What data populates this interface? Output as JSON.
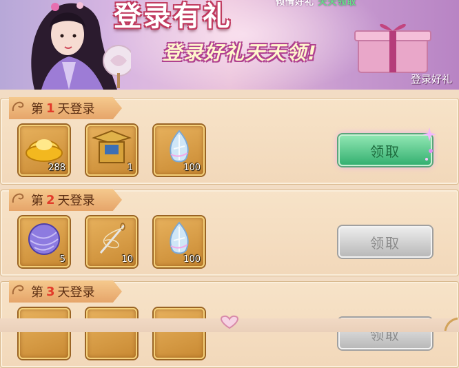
{
  "banner": {
    "title": "登录有礼",
    "subtitle": "登录好礼天天领!",
    "corner_label": "登录好礼",
    "top_strip_left": "倾情好礼",
    "top_strip_right": "天天领取"
  },
  "colors": {
    "claim_active": "#35b071",
    "day_number": "#e23b2a",
    "tab": "#e6a56a"
  },
  "days": [
    {
      "prefix": "第",
      "num": "1",
      "suffix": "天登录",
      "claim_label": "领取",
      "claim_state": "active",
      "items": [
        {
          "icon": "gold-ingot-icon",
          "qty": "288"
        },
        {
          "icon": "hat-box-icon",
          "qty": "1"
        },
        {
          "icon": "crystal-icon",
          "qty": "100"
        }
      ]
    },
    {
      "prefix": "第",
      "num": "2",
      "suffix": "天登录",
      "claim_label": "领取",
      "claim_state": "disabled",
      "items": [
        {
          "icon": "yarn-ball-icon",
          "qty": "5"
        },
        {
          "icon": "needle-thread-icon",
          "qty": "10"
        },
        {
          "icon": "crystal-icon",
          "qty": "100"
        }
      ]
    },
    {
      "prefix": "第",
      "num": "3",
      "suffix": "天登录",
      "claim_label": "领取",
      "claim_state": "disabled",
      "items": [
        {
          "icon": "item-icon",
          "qty": ""
        },
        {
          "icon": "item-icon",
          "qty": ""
        },
        {
          "icon": "crystal-icon",
          "qty": ""
        }
      ]
    }
  ]
}
